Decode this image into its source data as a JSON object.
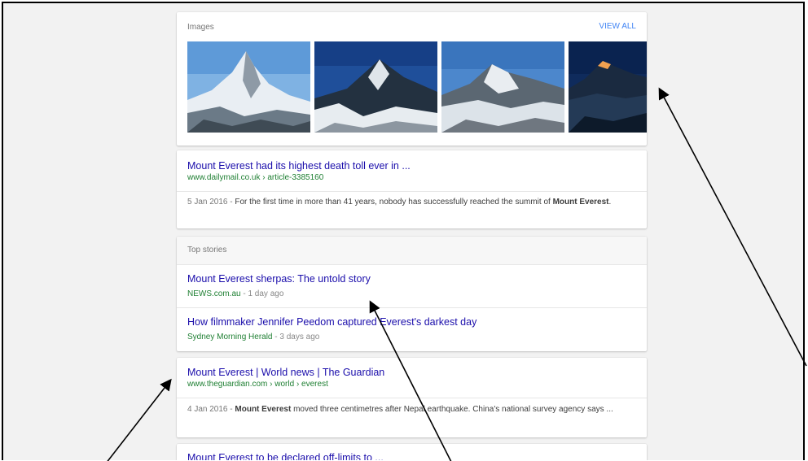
{
  "images": {
    "title": "Images",
    "view_all": "VIEW ALL"
  },
  "results": [
    {
      "title": "Mount Everest had its highest death toll ever in ...",
      "url": "www.dailymail.co.uk › article-3385160",
      "date": "5 Jan 2016",
      "sep": " - ",
      "snippet_a": "For the first time in more than 41 years, nobody has successfully reached the summit of ",
      "snippet_bold": "Mount Everest",
      "snippet_b": "."
    },
    {
      "title": "Mount Everest | World news | The Guardian",
      "url": "www.theguardian.com › world › everest",
      "date": "4 Jan 2016",
      "sep": " - ",
      "snippet_bold": "Mount Everest",
      "snippet_a": " moved three centimetres after Nepal earthquake. China's national survey agency says ..."
    },
    {
      "title": "Mount Everest to be declared off-limits to ..."
    }
  ],
  "top_stories": {
    "header": "Top stories",
    "items": [
      {
        "title": "Mount Everest sherpas: The untold story",
        "source": "NEWS.com.au",
        "time": " - 1 day ago"
      },
      {
        "title": "How filmmaker Jennifer Peedom captured Everest's darkest day",
        "source": "Sydney Morning Herald",
        "time": " - 3 days ago"
      }
    ]
  },
  "colors": {
    "link": "#1a0dab",
    "url_green": "#1e7f32",
    "view_all_blue": "#4285f4",
    "background": "#f2f2f2"
  }
}
